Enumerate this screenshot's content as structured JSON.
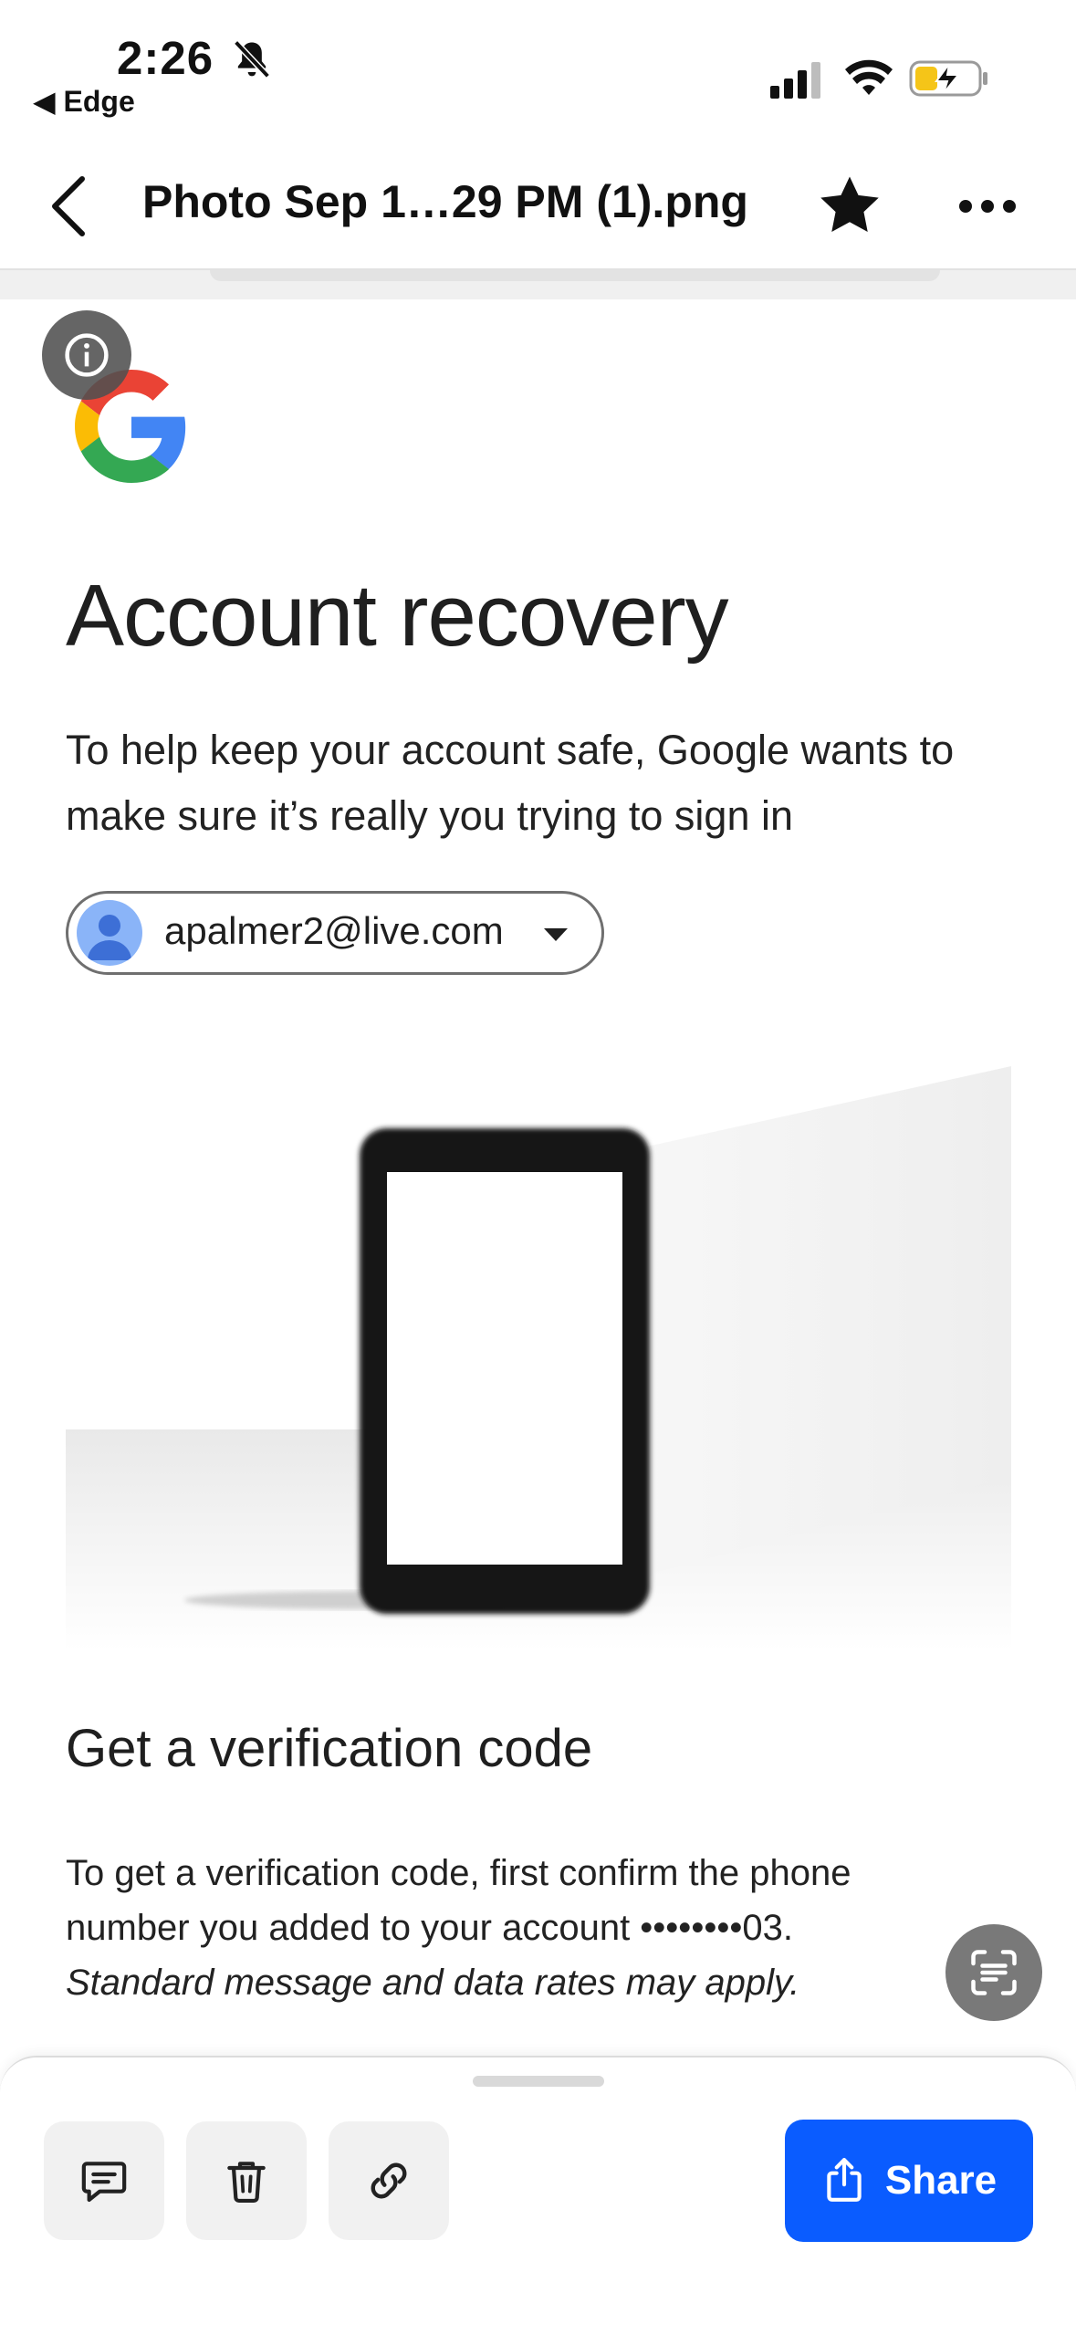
{
  "status_bar": {
    "time": "2:26",
    "back_app": "Edge",
    "icons": [
      "bell-slash-icon",
      "cellular-signal-icon",
      "wifi-icon",
      "battery-charging-icon"
    ]
  },
  "header": {
    "title": "Photo Sep 1…29 PM (1).png",
    "icons": [
      "chevron-left-icon",
      "star-icon",
      "more-icon"
    ]
  },
  "content": {
    "heading": "Account recovery",
    "intro": "To help keep your account safe, Google wants to make sure it’s really you trying to sign in",
    "account_email": "apalmer2@live.com",
    "verification_heading": "Get a verification code",
    "verification_text": "To get a verification code, first confirm the phone number you added to your account ••••••••03.",
    "rates_note": "Standard message and data rates may apply."
  },
  "toolbar": {
    "share_label": "Share",
    "icons": [
      "comment-icon",
      "trash-icon",
      "link-icon",
      "share-icon"
    ]
  },
  "colors": {
    "share_button": "#0a5cff",
    "google_blue": "#4285F4",
    "google_red": "#EA4335",
    "google_yellow": "#FBBC05",
    "google_green": "#34A853"
  }
}
